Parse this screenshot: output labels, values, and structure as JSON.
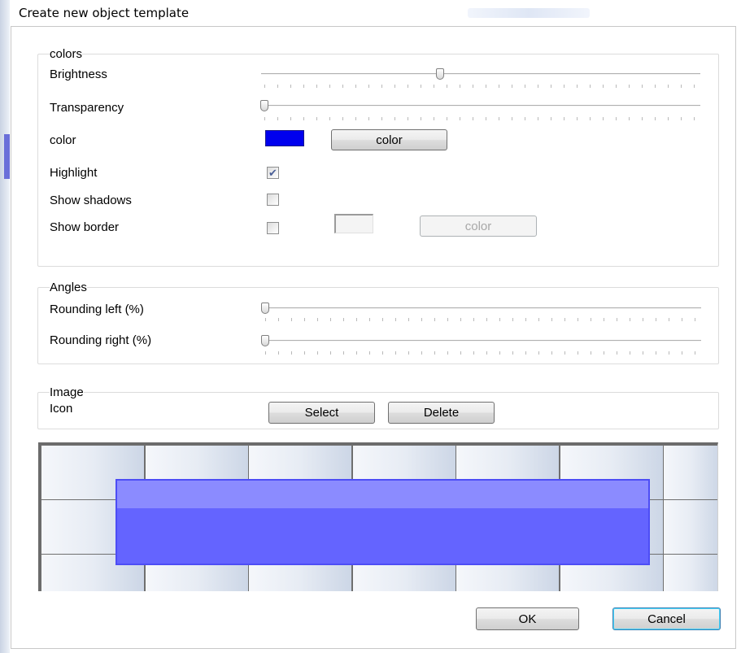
{
  "window": {
    "title": "Create new object template"
  },
  "colors_group": {
    "title": "colors",
    "brightness": {
      "label": "Brightness",
      "value_fraction": 0.4
    },
    "transparency": {
      "label": "Transparency",
      "value_fraction": 0.0
    },
    "color": {
      "label": "color",
      "swatch_color": "#0000ee",
      "button_label": "color"
    },
    "highlight": {
      "label": "Highlight",
      "checked": true
    },
    "show_shadows": {
      "label": "Show shadows",
      "checked": false
    },
    "show_border": {
      "label": "Show border",
      "checked": false,
      "button_label": "color",
      "button_enabled": false
    }
  },
  "angles_group": {
    "title": "Angles",
    "rounding_left": {
      "label": "Rounding left (%)",
      "value_fraction": 0.0
    },
    "rounding_right": {
      "label": "Rounding right (%)",
      "value_fraction": 0.0
    }
  },
  "image_group": {
    "title": "Image",
    "icon_label": "Icon",
    "select_label": "Select",
    "delete_label": "Delete"
  },
  "preview": {
    "object_color": "#6464ff",
    "border_color": "#4d4df5"
  },
  "footer": {
    "ok_label": "OK",
    "cancel_label": "Cancel"
  }
}
